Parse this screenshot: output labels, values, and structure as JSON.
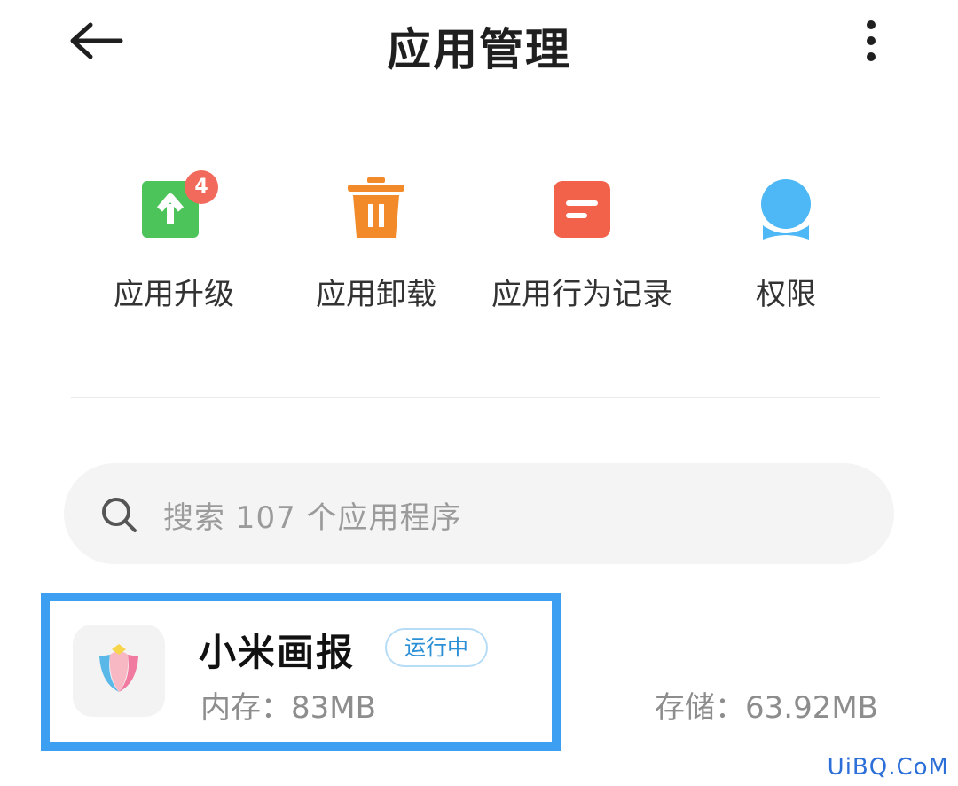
{
  "header": {
    "title": "应用管理",
    "back_icon": "arrow-left-icon",
    "more_icon": "more-vertical-icon"
  },
  "actions": [
    {
      "label": "应用升级",
      "icon": "upgrade-icon",
      "badge": "4",
      "color": "#4cc45a"
    },
    {
      "label": "应用卸载",
      "icon": "trash-icon",
      "color": "#f28a2a"
    },
    {
      "label": "应用行为记录",
      "icon": "record-icon",
      "color": "#f2614a"
    },
    {
      "label": "权限",
      "icon": "permission-icon",
      "color": "#4db8f5"
    }
  ],
  "search": {
    "placeholder": "搜索 107 个应用程序",
    "icon": "search-icon"
  },
  "apps": [
    {
      "name": "小米画报",
      "status": "运行中",
      "memory": "内存：83MB",
      "storage": "存储：63.92MB",
      "icon": "tulip-icon"
    }
  ],
  "colors": {
    "highlight": "#3d9ff2",
    "badge": "#f26a5b",
    "status_text": "#2b8fd6"
  },
  "watermark": "UiBQ.CoM"
}
